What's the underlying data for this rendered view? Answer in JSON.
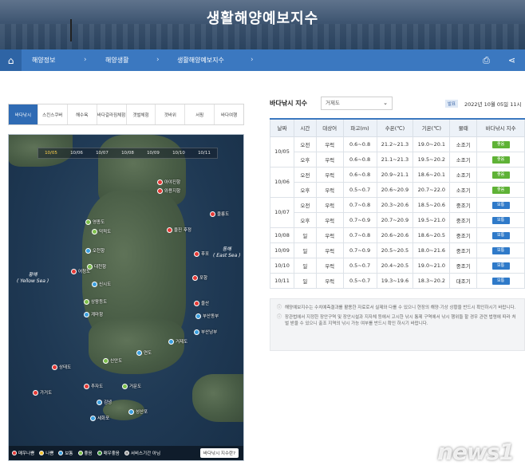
{
  "banner": {
    "title": "생활해양예보지수"
  },
  "nav": {
    "home_icon": "home-icon",
    "items": [
      "해양정보",
      "해양생활",
      "생활해양예보지수"
    ],
    "print_icon": "print-icon",
    "share_icon": "share-icon"
  },
  "tabs": [
    "바다낚시",
    "스킨스쿠버",
    "해수욕",
    "바다갈라짐체험",
    "갯벌체험",
    "갯바위",
    "서핑",
    "바다여행"
  ],
  "map": {
    "dates": [
      "10/05",
      "10/06",
      "10/07",
      "10/08",
      "10/09",
      "10/10",
      "10/11"
    ],
    "active_date": "10/05",
    "yellow_sea": "황해\n( Yellow Sea )",
    "east_sea": "동해\n( East Sea )",
    "markers": [
      {
        "name": "아야진항",
        "status": "bad"
      },
      {
        "name": "와용지항",
        "status": "bad"
      },
      {
        "name": "울릉도",
        "status": "bad"
      },
      {
        "name": "울진 후정",
        "status": "bad"
      },
      {
        "name": "후포",
        "status": "bad"
      },
      {
        "name": "포항",
        "status": "bad"
      },
      {
        "name": "울산",
        "status": "bad"
      },
      {
        "name": "영종도",
        "status": "good"
      },
      {
        "name": "덕적도",
        "status": "good"
      },
      {
        "name": "오천항",
        "status": "average"
      },
      {
        "name": "대천항",
        "status": "good"
      },
      {
        "name": "어청도",
        "status": "bad"
      },
      {
        "name": "신시도",
        "status": "average"
      },
      {
        "name": "상왕등도",
        "status": "good"
      },
      {
        "name": "계마항",
        "status": "average"
      },
      {
        "name": "부산동부",
        "status": "average"
      },
      {
        "name": "부산남부",
        "status": "average"
      },
      {
        "name": "거제도",
        "status": "average"
      },
      {
        "name": "연도",
        "status": "average"
      },
      {
        "name": "신안도",
        "status": "good"
      },
      {
        "name": "상태도",
        "status": "bad"
      },
      {
        "name": "추자도",
        "status": "bad"
      },
      {
        "name": "거문도",
        "status": "good"
      },
      {
        "name": "가거도",
        "status": "bad"
      },
      {
        "name": "김녕",
        "status": "average"
      },
      {
        "name": "성산포",
        "status": "average"
      },
      {
        "name": "세화포",
        "status": "average"
      }
    ],
    "legend": [
      {
        "label": "매우나쁨",
        "color": "#e53935"
      },
      {
        "label": "나쁨",
        "color": "#f2c12e"
      },
      {
        "label": "보통",
        "color": "#3ba0e0"
      },
      {
        "label": "좋음",
        "color": "#7dc04a"
      },
      {
        "label": "매우좋음",
        "color": "#3f9c3a"
      },
      {
        "label": "서비스기간 아님",
        "color": "#9e9e9e"
      }
    ],
    "legend_button": "바다낚시 지수란?"
  },
  "right": {
    "title": "바다낚시 지수",
    "region": "거제도",
    "badge": "발표",
    "date": "2022년 10월 05일 11시"
  },
  "table": {
    "headers": [
      "날짜",
      "시간",
      "대상어",
      "파고(m)",
      "수온(℃)",
      "기온(℃)",
      "물때",
      "바다낚시 지수"
    ],
    "rows": [
      {
        "date": "10/05",
        "time": "오전",
        "fish": "우럭",
        "wave": "0.6~0.8",
        "water": "21.2~21.3",
        "air": "19.0~20.1",
        "tide": "소조기",
        "index": "좋음"
      },
      {
        "date": "",
        "time": "오후",
        "fish": "우럭",
        "wave": "0.6~0.8",
        "water": "21.1~21.3",
        "air": "19.5~20.2",
        "tide": "소조기",
        "index": "좋음"
      },
      {
        "date": "10/06",
        "time": "오전",
        "fish": "우럭",
        "wave": "0.6~0.8",
        "water": "20.9~21.1",
        "air": "18.6~20.1",
        "tide": "소조기",
        "index": "좋음"
      },
      {
        "date": "",
        "time": "오후",
        "fish": "우럭",
        "wave": "0.5~0.7",
        "water": "20.6~20.9",
        "air": "20.7~22.0",
        "tide": "소조기",
        "index": "좋음"
      },
      {
        "date": "10/07",
        "time": "오전",
        "fish": "우럭",
        "wave": "0.7~0.8",
        "water": "20.3~20.6",
        "air": "18.5~20.6",
        "tide": "중조기",
        "index": "보통"
      },
      {
        "date": "",
        "time": "오후",
        "fish": "우럭",
        "wave": "0.7~0.9",
        "water": "20.7~20.9",
        "air": "19.5~21.0",
        "tide": "중조기",
        "index": "보통"
      },
      {
        "date": "10/08",
        "time": "일",
        "fish": "우럭",
        "wave": "0.7~0.8",
        "water": "20.6~20.6",
        "air": "18.6~20.5",
        "tide": "중조기",
        "index": "보통"
      },
      {
        "date": "10/09",
        "time": "일",
        "fish": "우럭",
        "wave": "0.7~0.9",
        "water": "20.5~20.5",
        "air": "18.0~21.6",
        "tide": "중조기",
        "index": "보통"
      },
      {
        "date": "10/10",
        "time": "일",
        "fish": "우럭",
        "wave": "0.5~0.7",
        "water": "20.4~20.5",
        "air": "19.0~21.0",
        "tide": "중조기",
        "index": "보통"
      },
      {
        "date": "10/11",
        "time": "일",
        "fish": "우럭",
        "wave": "0.5~0.7",
        "water": "19.3~19.6",
        "air": "18.3~20.2",
        "tide": "대조기",
        "index": "보통"
      }
    ]
  },
  "notes": [
    "해양예보지수는 수치예측결과를 활용한 자료로서 실제와 다를 수 있으니 현장의 해양·기상 상황을 반드시 확인하시기 바랍니다.",
    "장관법에서 지정한 장안구역 및 장안시설과 지자체 등에서 고시한 낚시 통제 구역에서 낚시 행위들 할 경우 관련 법령에 따라 처벌 받을 수 있으니 출조 지역의 낚시 가능 여부를 반드시 확인 하시기 바랍니다."
  ],
  "watermark": "news1",
  "colors": {
    "good": "#5fb236",
    "average": "#2f7ac9",
    "bad": "#e53935",
    "nav": "#3b78c0"
  }
}
